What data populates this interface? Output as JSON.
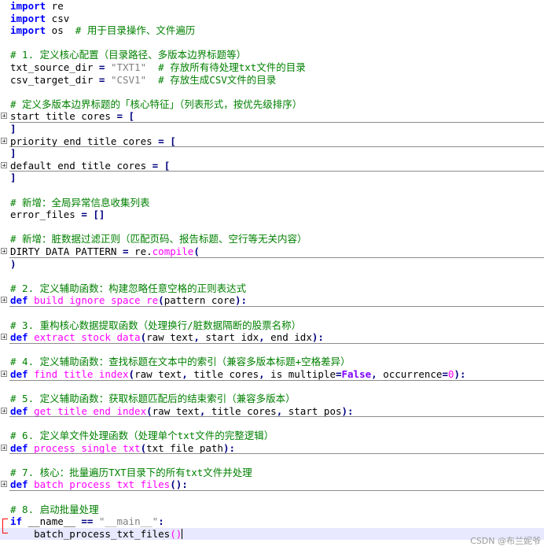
{
  "editor": {
    "lines": [
      {
        "tokens": [
          {
            "t": "import",
            "c": "kw"
          },
          {
            "t": " re"
          }
        ]
      },
      {
        "tokens": [
          {
            "t": "import",
            "c": "kw"
          },
          {
            "t": " csv"
          }
        ]
      },
      {
        "tokens": [
          {
            "t": "import",
            "c": "kw"
          },
          {
            "t": " os  "
          },
          {
            "t": "# 用于目录操作、文件遍历",
            "c": "cm"
          }
        ]
      },
      {
        "tokens": []
      },
      {
        "tokens": [
          {
            "t": "# 1. 定义核心配置（目录路径、多版本边界标题等）",
            "c": "cm"
          }
        ]
      },
      {
        "tokens": [
          {
            "t": "txt_source_dir "
          },
          {
            "t": "=",
            "c": "op"
          },
          {
            "t": " "
          },
          {
            "t": "\"TXT1\"",
            "c": "st"
          },
          {
            "t": "  "
          },
          {
            "t": "# 存放所有待处理txt文件的目录",
            "c": "cm"
          }
        ]
      },
      {
        "tokens": [
          {
            "t": "csv_target_dir "
          },
          {
            "t": "=",
            "c": "op"
          },
          {
            "t": " "
          },
          {
            "t": "\"CSV1\"",
            "c": "st"
          },
          {
            "t": "  "
          },
          {
            "t": "# 存放生成CSV文件的目录",
            "c": "cm"
          }
        ]
      },
      {
        "tokens": []
      },
      {
        "tokens": [
          {
            "t": "# 定义多版本边界标题的「核心特征」（列表形式，按优先级排序）",
            "c": "cm"
          }
        ]
      },
      {
        "fold": "box",
        "rule": true,
        "tokens": [
          {
            "t": "start title cores "
          },
          {
            "t": "=",
            "c": "op"
          },
          {
            "t": " "
          },
          {
            "t": "[",
            "c": "op"
          }
        ]
      },
      {
        "tokens": [
          {
            "t": "]",
            "c": "op"
          }
        ]
      },
      {
        "fold": "box",
        "rule": true,
        "tokens": [
          {
            "t": "priority end title cores "
          },
          {
            "t": "=",
            "c": "op"
          },
          {
            "t": " "
          },
          {
            "t": "[",
            "c": "op"
          }
        ]
      },
      {
        "tokens": [
          {
            "t": "]",
            "c": "op"
          }
        ]
      },
      {
        "fold": "box",
        "rule": true,
        "tokens": [
          {
            "t": "default end title cores "
          },
          {
            "t": "=",
            "c": "op"
          },
          {
            "t": " "
          },
          {
            "t": "[",
            "c": "op"
          }
        ]
      },
      {
        "tokens": [
          {
            "t": "]",
            "c": "op"
          }
        ]
      },
      {
        "tokens": []
      },
      {
        "tokens": [
          {
            "t": "# 新增：全局异常信息收集列表",
            "c": "cm"
          }
        ]
      },
      {
        "tokens": [
          {
            "t": "error_files "
          },
          {
            "t": "=",
            "c": "op"
          },
          {
            "t": " "
          },
          {
            "t": "[]",
            "c": "op"
          }
        ]
      },
      {
        "tokens": []
      },
      {
        "tokens": [
          {
            "t": "# 新增：脏数据过滤正则（匹配页码、报告标题、空行等无关内容）",
            "c": "cm"
          }
        ]
      },
      {
        "fold": "box",
        "rule": true,
        "tokens": [
          {
            "t": "DIRTY DATA PATTERN "
          },
          {
            "t": "=",
            "c": "op"
          },
          {
            "t": " re."
          },
          {
            "t": "compile",
            "c": "fn"
          },
          {
            "t": "(",
            "c": "op"
          }
        ]
      },
      {
        "tokens": [
          {
            "t": ")",
            "c": "op"
          }
        ]
      },
      {
        "tokens": []
      },
      {
        "tokens": [
          {
            "t": "# 2. 定义辅助函数：构建忽略任意空格的正则表达式",
            "c": "cm"
          }
        ]
      },
      {
        "fold": "box",
        "rule": true,
        "tokens": [
          {
            "t": "def",
            "c": "kw"
          },
          {
            "t": " "
          },
          {
            "t": "build ignore space re",
            "c": "fn"
          },
          {
            "t": "(",
            "c": "op"
          },
          {
            "t": "pattern core"
          },
          {
            "t": "):",
            "c": "op"
          }
        ]
      },
      {
        "tokens": []
      },
      {
        "tokens": [
          {
            "t": "# 3. 重构核心数据提取函数（处理换行/脏数据隔断的股票名称）",
            "c": "cm"
          }
        ]
      },
      {
        "fold": "box",
        "rule": true,
        "tokens": [
          {
            "t": "def",
            "c": "kw"
          },
          {
            "t": " "
          },
          {
            "t": "extract stock data",
            "c": "fn"
          },
          {
            "t": "(",
            "c": "op"
          },
          {
            "t": "raw text"
          },
          {
            "t": ",",
            "c": "op"
          },
          {
            "t": " start idx"
          },
          {
            "t": ",",
            "c": "op"
          },
          {
            "t": " end idx"
          },
          {
            "t": "):",
            "c": "op"
          }
        ]
      },
      {
        "tokens": []
      },
      {
        "tokens": [
          {
            "t": "# 4. 定义辅助函数：查找标题在文本中的索引（兼容多版本标题+空格差异）",
            "c": "cm"
          }
        ]
      },
      {
        "fold": "box",
        "rule": true,
        "tokens": [
          {
            "t": "def",
            "c": "kw"
          },
          {
            "t": " "
          },
          {
            "t": "find title index",
            "c": "fn"
          },
          {
            "t": "(",
            "c": "op"
          },
          {
            "t": "raw text"
          },
          {
            "t": ",",
            "c": "op"
          },
          {
            "t": " title cores"
          },
          {
            "t": ",",
            "c": "op"
          },
          {
            "t": " is multiple"
          },
          {
            "t": "=",
            "c": "op"
          },
          {
            "t": "False",
            "c": "cst"
          },
          {
            "t": ",",
            "c": "op"
          },
          {
            "t": " occurrence"
          },
          {
            "t": "=",
            "c": "op"
          },
          {
            "t": "0",
            "c": "num"
          },
          {
            "t": "):",
            "c": "op"
          }
        ]
      },
      {
        "tokens": []
      },
      {
        "tokens": [
          {
            "t": "# 5. 定义辅助函数：获取标题匹配后的结束索引（兼容多版本）",
            "c": "cm"
          }
        ]
      },
      {
        "fold": "box",
        "rule": true,
        "tokens": [
          {
            "t": "def",
            "c": "kw"
          },
          {
            "t": " "
          },
          {
            "t": "get title end index",
            "c": "fn"
          },
          {
            "t": "(",
            "c": "op"
          },
          {
            "t": "raw text"
          },
          {
            "t": ",",
            "c": "op"
          },
          {
            "t": " title cores"
          },
          {
            "t": ",",
            "c": "op"
          },
          {
            "t": " start pos"
          },
          {
            "t": "):",
            "c": "op"
          }
        ]
      },
      {
        "tokens": []
      },
      {
        "tokens": [
          {
            "t": "# 6. 定义单文件处理函数（处理单个txt文件的完整逻辑）",
            "c": "cm"
          }
        ]
      },
      {
        "fold": "box",
        "rule": true,
        "tokens": [
          {
            "t": "def",
            "c": "kw"
          },
          {
            "t": " "
          },
          {
            "t": "process single txt",
            "c": "fn"
          },
          {
            "t": "(",
            "c": "op"
          },
          {
            "t": "txt file path"
          },
          {
            "t": "):",
            "c": "op"
          }
        ]
      },
      {
        "tokens": []
      },
      {
        "tokens": [
          {
            "t": "# 7. 核心：批量遍历TXT目录下的所有txt文件并处理",
            "c": "cm"
          }
        ]
      },
      {
        "fold": "box",
        "rule": true,
        "tokens": [
          {
            "t": "def",
            "c": "kw"
          },
          {
            "t": " "
          },
          {
            "t": "batch process txt files",
            "c": "fn"
          },
          {
            "t": "():",
            "c": "op"
          }
        ]
      },
      {
        "tokens": []
      },
      {
        "tokens": [
          {
            "t": "# 8. 启动批量处理",
            "c": "cm"
          }
        ]
      },
      {
        "fold": "red-top",
        "tokens": [
          {
            "t": "if",
            "c": "kw"
          },
          {
            "t": " __name__ "
          },
          {
            "t": "==",
            "c": "op"
          },
          {
            "t": " "
          },
          {
            "t": "\"__main__\"",
            "c": "st"
          },
          {
            "t": ":",
            "c": "op"
          }
        ]
      },
      {
        "fold": "red-bot",
        "current": true,
        "caret": true,
        "tokens": [
          {
            "t": "    batch_process_txt_files"
          },
          {
            "t": "()",
            "c": "pr"
          }
        ]
      }
    ]
  },
  "watermark": "CSDN @布兰妮爷"
}
